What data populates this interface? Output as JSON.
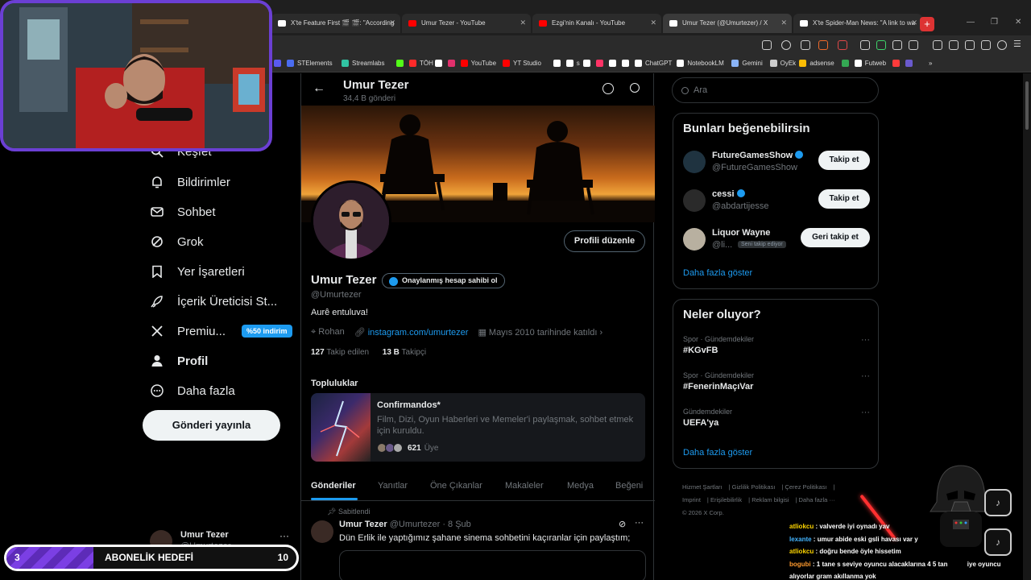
{
  "browser": {
    "tabs": [
      {
        "title": "X'te Feature First 🎬 🎬: \"According",
        "color": "#ff4b4b"
      },
      {
        "title": "Umur Tezer - YouTube",
        "color": "#ff0000"
      },
      {
        "title": "Ezgi'nin Kanalı - YouTube",
        "color": "#ff0000"
      },
      {
        "title": "Umur Tezer (@Umurtezer) / X",
        "color": "#ffffff"
      },
      {
        "title": "X'te Spider-Man News: \"A link to wa",
        "color": "#ffffff"
      }
    ],
    "new_tab": "+",
    "bookmarks": [
      {
        "label": "",
        "color": "#5a5af0"
      },
      {
        "label": "STElements",
        "color": "#4a6cf0"
      },
      {
        "label": "Streamlabs",
        "color": "#31c3a2"
      },
      {
        "label": "",
        "color": "#53fc18"
      },
      {
        "label": "TÖH",
        "color": "#ff2a2a"
      },
      {
        "label": "",
        "color": "#ffffff"
      },
      {
        "label": "",
        "color": "#e1306c"
      },
      {
        "label": "YouTube",
        "color": "#ff0000"
      },
      {
        "label": "YT Studio",
        "color": "#ff0000"
      },
      {
        "label": "",
        "color": "#ffffff"
      },
      {
        "label": "s",
        "color": "#ffffff"
      },
      {
        "label": "",
        "color": "#ffffff"
      },
      {
        "label": "",
        "color": "#ff3366"
      },
      {
        "label": "",
        "color": "#ffffff"
      },
      {
        "label": "",
        "color": "#ffffff"
      },
      {
        "label": "ChatGPT",
        "color": "#ffffff"
      },
      {
        "label": "NotebookLM",
        "color": "#ffffff"
      },
      {
        "label": "Gemini",
        "color": "#8ab4f8"
      },
      {
        "label": "OyEk",
        "color": "#cccccc"
      },
      {
        "label": "adsense",
        "color": "#fbbc04"
      },
      {
        "label": "",
        "color": "#34a853"
      },
      {
        "label": "Futweb",
        "color": "#ffffff"
      },
      {
        "label": "",
        "color": "#ff3b3b"
      },
      {
        "label": "",
        "color": "#6a5acd"
      },
      {
        "label": "»",
        "color": "transparent"
      }
    ]
  },
  "nav": {
    "items": [
      {
        "label": "Keşfet",
        "icon": "search-icon"
      },
      {
        "label": "Bildirimler",
        "icon": "bell-icon"
      },
      {
        "label": "Sohbet",
        "icon": "mail-icon"
      },
      {
        "label": "Grok",
        "icon": "grok-icon"
      },
      {
        "label": "Yer İşaretleri",
        "icon": "bookmark-icon"
      },
      {
        "label": "İçerik Üreticisi St...",
        "icon": "rocket-icon"
      },
      {
        "label": "Premiu...",
        "icon": "x-logo-icon"
      },
      {
        "label": "Profil",
        "icon": "person-icon"
      },
      {
        "label": "Daha fazla",
        "icon": "more-circle-icon"
      }
    ],
    "premium_badge": "%50 indirim",
    "post_button": "Gönderi yayınla",
    "account": {
      "name": "Umur Tezer",
      "handle": "@Umurtezer",
      "more": "···"
    }
  },
  "profile": {
    "header_name": "Umur Tezer",
    "header_count": "34,4 B gönderi",
    "edit_button": "Profili düzenle",
    "name": "Umur Tezer",
    "verify_pill": "Onaylanmış hesap sahibi ol",
    "handle": "@Umurtezer",
    "bio": "Aurê entuluva!",
    "location": "Rohan",
    "link": "instagram.com/umurtezer",
    "joined": "Mayıs 2010 tarihinde katıldı",
    "following_count": "127",
    "following_label": "Takip edilen",
    "followers_count": "13 B",
    "followers_label": "Takipçi"
  },
  "communities": {
    "title": "Topluluklar",
    "name": "Confirmandos*",
    "description": "Film, Dizi, Oyun Haberleri ve Memeler'i paylaşmak, sohbet etmek için kuruldu.",
    "members_count": "621",
    "members_label": "Üye"
  },
  "tabs": [
    "Gönderiler",
    "Yanıtlar",
    "Öne Çıkanlar",
    "Makaleler",
    "Medya",
    "Beğeni"
  ],
  "pinned_tweet": {
    "pinned_label": "Sabitlendi",
    "author": "Umur Tezer",
    "meta": "@Umurtezer · 8 Şub",
    "text": "Dün Erlik ile yaptığımız şahane sinema sohbetini kaçıranlar için paylaştım;"
  },
  "search": {
    "placeholder": "Ara"
  },
  "who_to_follow": {
    "title": "Bunları beğenebilirsin",
    "items": [
      {
        "name": "FutureGamesShow",
        "handle": "@FutureGamesShow",
        "verified": true,
        "button": "Takip et",
        "follows_you": ""
      },
      {
        "name": "cessi",
        "handle": "@abdartijesse",
        "verified": true,
        "button": "Takip et",
        "follows_you": ""
      },
      {
        "name": "Liquor Wayne",
        "handle": "@li...",
        "verified": false,
        "button": "Geri takip et",
        "follows_you": "Seni takip ediyor"
      }
    ],
    "show_more": "Daha fazla göster"
  },
  "trends": {
    "title": "Neler oluyor?",
    "items": [
      {
        "context": "Spor · Gündemdekiler",
        "topic": "#KGvFB"
      },
      {
        "context": "Spor · Gündemdekiler",
        "topic": "#FenerinMaçıVar"
      },
      {
        "context": "Gündemdekiler",
        "topic": "UEFA'ya"
      }
    ],
    "show_more": "Daha fazla göster",
    "more_icon": "···"
  },
  "footer": [
    "Hizmet Şartları",
    "Gizlilik Politikası",
    "Çerez Politikası",
    "Imprint",
    "Erişilebilirlik",
    "Reklam bilgisi",
    "Daha fazla ···",
    "© 2026 X Corp."
  ],
  "overlay": {
    "goal_current": "3",
    "goal_label": "ABONELİK HEDEFİ",
    "goal_target": "10",
    "goal_progress": 0.3,
    "chat": [
      {
        "user": "atliokcu",
        "text": "valverde iyi oynadı yav",
        "color": "u1"
      },
      {
        "user": "lexante",
        "text": "umur abide eski gsli havası var y",
        "color": "u2"
      },
      {
        "user": "atliokcu",
        "text": "doğru bende öyle hissetim",
        "color": "u1"
      },
      {
        "user": "bogubi",
        "text": "1 tane s seviye oyuncu alacaklarına 4 5 tan",
        "color": "u3"
      }
    ],
    "chat_cont_a": "iye oyuncu",
    "chat_cont_b": "alıyorlar gram akıllanma yok"
  },
  "colors": {
    "accent": "#1d9bf0",
    "background": "#000000",
    "stream_purple": "#6b3fd4"
  }
}
